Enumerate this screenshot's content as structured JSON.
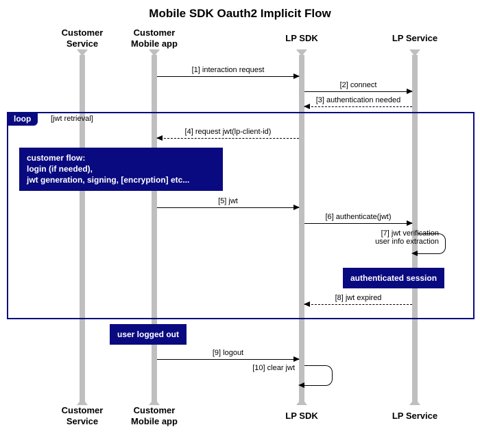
{
  "title": "Mobile SDK Oauth2 Implicit Flow",
  "lanes": {
    "customer_service": "Customer\nService",
    "customer_mobile_app": "Customer\nMobile app",
    "lp_sdk": "LP SDK",
    "lp_service": "LP Service"
  },
  "loop": {
    "label": "loop",
    "condition": "[jwt retrieval]"
  },
  "messages": {
    "m1": "[1] interaction request",
    "m2": "[2] connect",
    "m3": "[3] authentication needed",
    "m4": "[4] request  jwt(lp-client-id)",
    "m5": "[5] jwt",
    "m6": "[6] authenticate(jwt)",
    "m7": "[7] jwt verification\nuser info extraction",
    "m8": "[8] jwt expired",
    "m9": "[9] logout",
    "m10": "[10] clear jwt"
  },
  "notes": {
    "customer_flow": "customer flow:\nlogin (if needed),\njwt generation, signing, [encryption] etc...",
    "authenticated_session": "authenticated session",
    "user_logged_out": "user logged out"
  }
}
